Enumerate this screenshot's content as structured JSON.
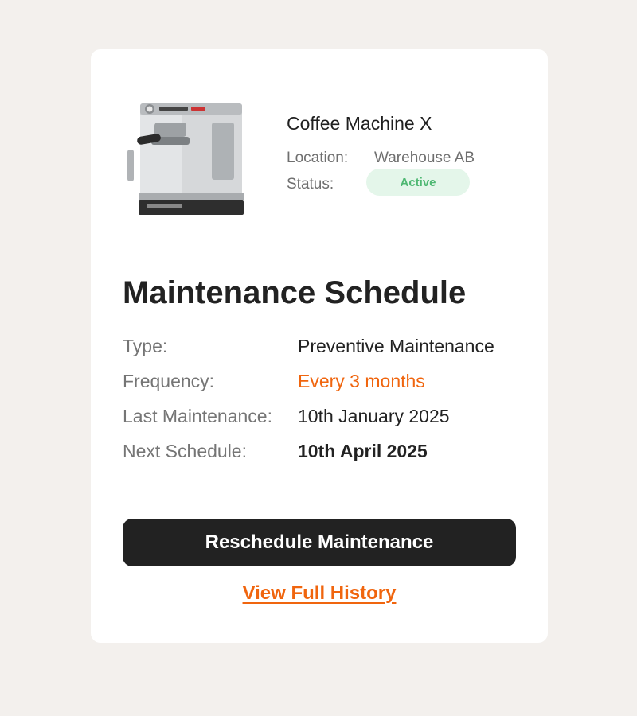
{
  "device": {
    "name": "Coffee Machine X",
    "location_label": "Location:",
    "location_value": "Warehouse AB",
    "status_label": "Status:",
    "status_value": "Active",
    "image_icon": "espresso-machine"
  },
  "schedule": {
    "title": "Maintenance Schedule",
    "rows": [
      {
        "label": "Type:",
        "value": "Preventive Maintenance"
      },
      {
        "label": "Frequency:",
        "value": "Every 3 months"
      },
      {
        "label": "Last Maintenance:",
        "value": "10th January 2025"
      },
      {
        "label": "Next Schedule:",
        "value": "10th April 2025"
      }
    ]
  },
  "actions": {
    "reschedule_label": "Reschedule Maintenance",
    "history_label": "View Full History"
  },
  "colors": {
    "accent": "#f0650e",
    "status_bg": "#e4f6ea",
    "status_text": "#4fb873",
    "button_bg": "#222222"
  }
}
